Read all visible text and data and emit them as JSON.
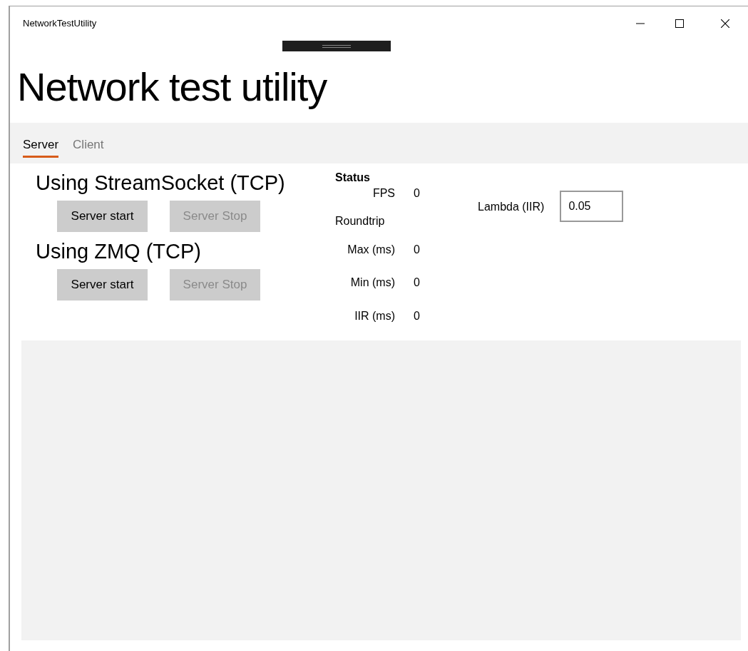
{
  "window": {
    "title": "NetworkTestUtility"
  },
  "page_title": "Network test utility",
  "tabs": [
    {
      "label": "Server",
      "selected": true
    },
    {
      "label": "Client",
      "selected": false
    }
  ],
  "sections": [
    {
      "heading": "Using StreamSocket (TCP)",
      "buttons": [
        {
          "label": "Server start",
          "disabled": false
        },
        {
          "label": "Server Stop",
          "disabled": true
        }
      ]
    },
    {
      "heading": "Using ZMQ (TCP)",
      "buttons": [
        {
          "label": "Server start",
          "disabled": false
        },
        {
          "label": "Server Stop",
          "disabled": true
        }
      ]
    }
  ],
  "status": {
    "heading": "Status",
    "rows": [
      {
        "kind": "metric",
        "label": "FPS",
        "value": "0"
      },
      {
        "kind": "group",
        "label": "Roundtrip"
      },
      {
        "kind": "metric",
        "label": "Max (ms)",
        "value": "0"
      },
      {
        "kind": "metric",
        "label": "Min (ms)",
        "value": "0"
      },
      {
        "kind": "metric",
        "label": "IIR (ms)",
        "value": "0"
      }
    ]
  },
  "lambda": {
    "label": "Lambda (IIR)",
    "value": "0.05"
  }
}
